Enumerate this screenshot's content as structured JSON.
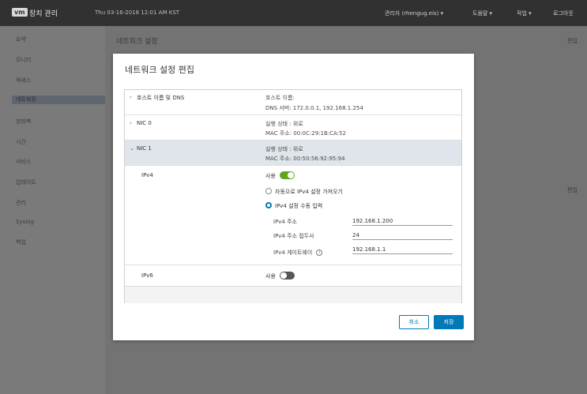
{
  "header": {
    "logo": "vm",
    "app_title": "장치 관리",
    "datetime": "Thu 03-16-2018 12:01 AM KST",
    "user": "관리자 (rhengug.eis) ▾",
    "help": "도움말 ▾",
    "actions": "작업 ▾",
    "logout": "로그아웃"
  },
  "sidebar": {
    "items": [
      {
        "label": "요약"
      },
      {
        "label": "모니터"
      },
      {
        "label": "액세스"
      },
      {
        "label": "네트워킹"
      },
      {
        "label": "방화벽"
      },
      {
        "label": "시간"
      },
      {
        "label": "서비스"
      },
      {
        "label": "업데이트"
      },
      {
        "label": "관리"
      },
      {
        "label": "Syslog"
      },
      {
        "label": "백업"
      }
    ],
    "active_index": 3
  },
  "background": {
    "title": "네트워크 설정",
    "edit_label": "편집"
  },
  "modal": {
    "title": "네트워크 설정 편집",
    "rows": {
      "hostname": {
        "label": "호스트 이름 및 DNS",
        "line1": "호스트 이름:",
        "line2": "DNS 서버: 172.0.0.1, 192.168.1.254"
      },
      "nic0": {
        "label": "NIC 0",
        "line1": "실행 상태 : 위로",
        "line2": "MAC 주소: 00:0C:29:1B:CA:52"
      },
      "nic1": {
        "label": "NIC 1",
        "line1": "실행 상태 : 위로",
        "line2": "MAC 주소: 00:50:56:92:95:94"
      }
    },
    "ipv4": {
      "section_label": "IPv4",
      "toggle_label": "사용",
      "enabled": true,
      "radio_auto": "자동으로 IPv4 설정 가져오기",
      "radio_manual": "IPv4 설정 수동 입력",
      "selected": "manual",
      "fields": [
        {
          "label": "IPv4 주소",
          "value": "192.168.1.200"
        },
        {
          "label": "IPv4 주소 접두사",
          "value": "24"
        },
        {
          "label": "IPv4 게이트웨이",
          "value": "192.168.1.1"
        }
      ]
    },
    "ipv6": {
      "section_label": "IPv6",
      "toggle_label": "사용",
      "enabled": false
    },
    "buttons": {
      "cancel": "취소",
      "save": "저장"
    },
    "colors": {
      "accent": "#0079b8",
      "toggle_on": "#62a420",
      "toggle_off": "#565656"
    }
  }
}
